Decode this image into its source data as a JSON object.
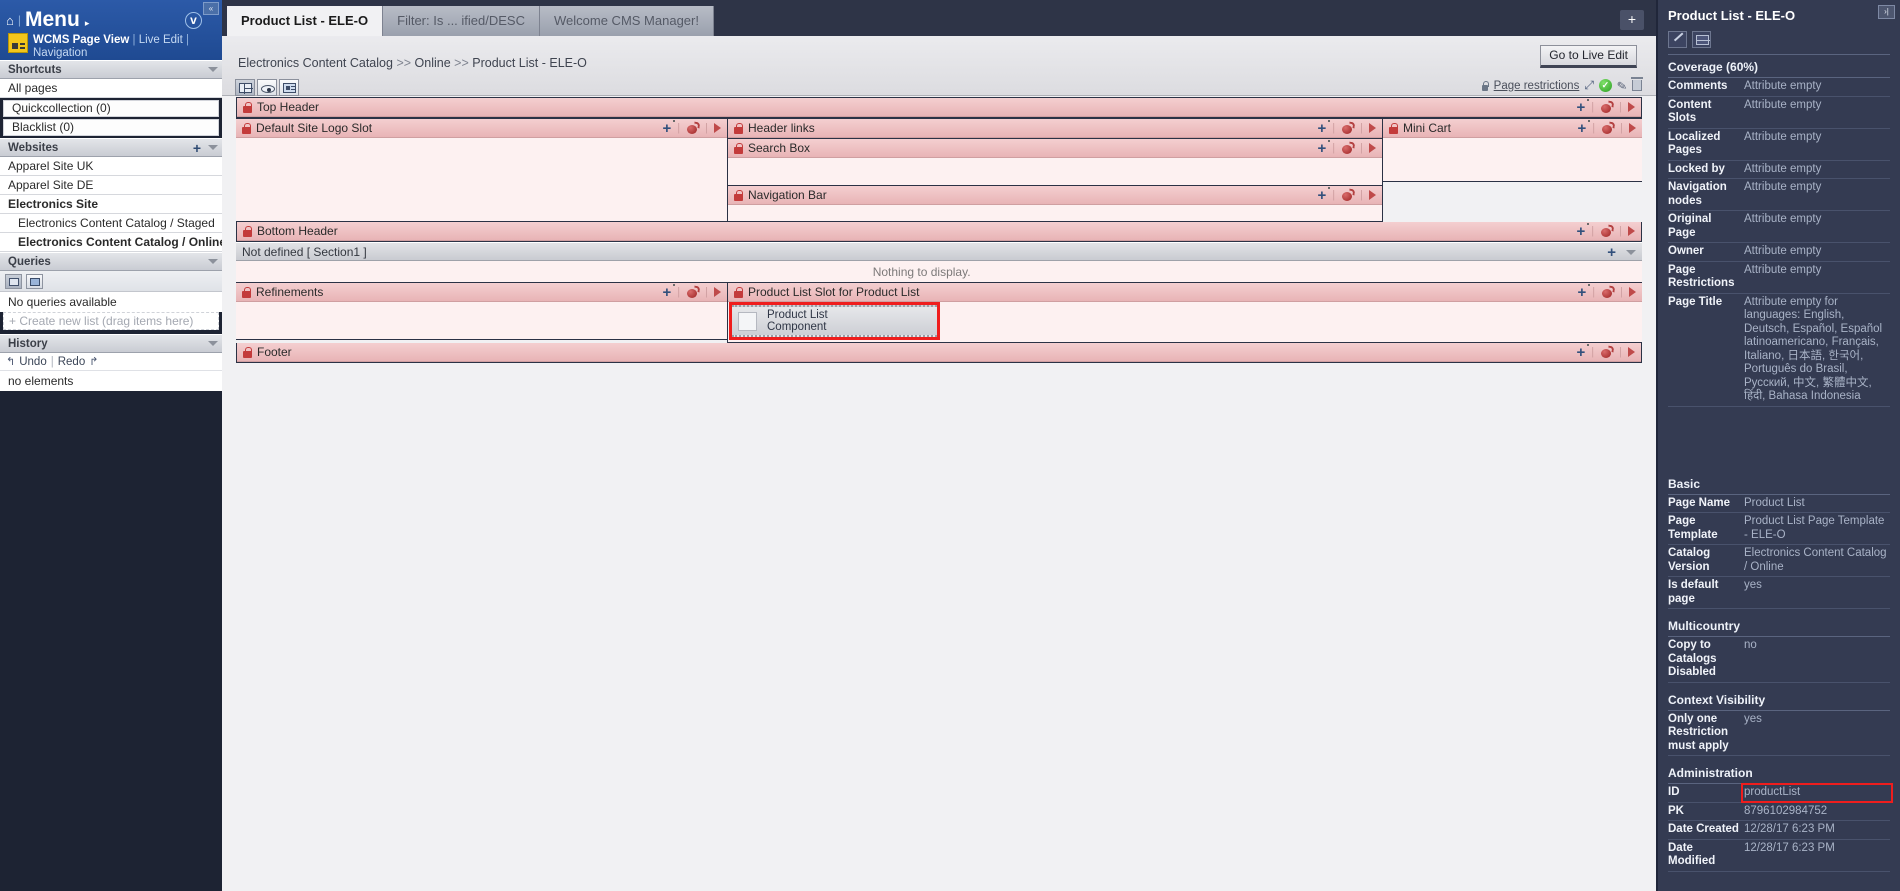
{
  "sidebar": {
    "collapse_icon": "«",
    "home_icon": "⌂",
    "menu_label": "Menu",
    "menu_caret": "▸",
    "version_badge": "v",
    "page_view_label": "WCMS Page View",
    "live_edit_label": "Live Edit",
    "navigation_label": "Navigation",
    "sections": {
      "shortcuts": {
        "title": "Shortcuts",
        "items": [
          {
            "label": "All pages",
            "style": "plain"
          },
          {
            "label": "Quickcollection (0)",
            "style": "boxed"
          },
          {
            "label": "Blacklist (0)",
            "style": "boxed"
          }
        ]
      },
      "websites": {
        "title": "Websites",
        "items": [
          {
            "label": "Apparel Site UK",
            "style": "plain"
          },
          {
            "label": "Apparel Site DE",
            "style": "plain"
          },
          {
            "label": "Electronics Site",
            "style": "bold"
          },
          {
            "label": "Electronics Content Catalog / Staged",
            "style": "indent-reg"
          },
          {
            "label": "Electronics Content Catalog / Online",
            "style": "indent"
          }
        ]
      },
      "queries": {
        "title": "Queries",
        "tool_icons": [
          "query-list-icon",
          "query-saved-icon"
        ],
        "empty_text": "No queries available",
        "create_text": "+ Create new list (drag items here)"
      },
      "history": {
        "title": "History",
        "undo_label": "Undo",
        "redo_label": "Redo",
        "empty_text": "no elements"
      }
    }
  },
  "tabs": [
    {
      "label": "Product List - ELE-O",
      "active": true
    },
    {
      "label": "Filter: Is ... ified/DESC",
      "active": false
    },
    {
      "label": "Welcome CMS Manager!",
      "active": false
    }
  ],
  "tab_add_label": "+",
  "breadcrumb": {
    "parts": [
      "Electronics Content Catalog",
      "Online",
      "Product List - ELE-O"
    ],
    "separator": ">>"
  },
  "live_edit_button": "Go to Live Edit",
  "view_tools": [
    "slot-grid-icon",
    "preview-eye-icon",
    "component-card-icon"
  ],
  "restrictions": {
    "lock_icon": "lock-icon",
    "label": "Page restrictions",
    "icons": [
      "move-icon",
      "approved-check-icon",
      "edit-pencil-icon",
      "delete-trash-icon"
    ]
  },
  "slots": {
    "top_header": "Top Header",
    "default_site_logo_slot": "Default Site Logo Slot",
    "header_links": "Header links",
    "search_box": "Search Box",
    "mini_cart": "Mini Cart",
    "navigation_bar": "Navigation Bar",
    "bottom_header": "Bottom Header",
    "not_defined": "Not defined [ Section1 ]",
    "nothing_to_display": "Nothing to display.",
    "refinements": "Refinements",
    "product_list_slot": "Product List Slot for Product List",
    "footer": "Footer",
    "component": {
      "line1": "Product List",
      "line2": "Component"
    },
    "action_icons": [
      "add-plus-icon",
      "bomb-icon",
      "play-icon"
    ]
  },
  "right_panel": {
    "title": "Product List - ELE-O",
    "expand_icon": "›|",
    "tools": [
      "edit-pencil-icon",
      "properties-table-icon"
    ],
    "groups": [
      {
        "title": "Coverage  (60%)",
        "rows": [
          {
            "key": "Comments",
            "value": "Attribute empty"
          },
          {
            "key": "Content Slots",
            "value": "Attribute empty"
          },
          {
            "key": "Localized Pages",
            "value": "Attribute empty"
          },
          {
            "key": "Locked by",
            "value": "Attribute empty"
          },
          {
            "key": "Navigation nodes",
            "value": "Attribute empty"
          },
          {
            "key": "Original Page",
            "value": "Attribute empty"
          },
          {
            "key": "Owner",
            "value": "Attribute empty"
          },
          {
            "key": "Page Restrictions",
            "value": "Attribute empty"
          },
          {
            "key": "Page Title",
            "value": "Attribute empty for languages: English, Deutsch, Español, Español latinoamericano, Français, Italiano, 日本語, 한국어, Português do Brasil, Русский, 中文, 繁體中文, हिंदी, Bahasa Indonesia"
          }
        ]
      },
      {
        "title": "Basic",
        "rows": [
          {
            "key": "Page Name",
            "value": "Product List"
          },
          {
            "key": "Page Template",
            "value": "Product List Page Template - ELE-O"
          },
          {
            "key": "Catalog Version",
            "value": "Electronics Content Catalog / Online"
          },
          {
            "key": "Is default page",
            "value": "yes"
          }
        ]
      },
      {
        "title": "Multicountry",
        "rows": [
          {
            "key": "Copy to Catalogs Disabled",
            "value": "no"
          }
        ]
      },
      {
        "title": "Context Visibility",
        "rows": [
          {
            "key": "Only one Restriction must apply",
            "value": "yes"
          }
        ]
      },
      {
        "title": "Administration",
        "rows": [
          {
            "key": "ID",
            "value": "productList",
            "highlight": true
          },
          {
            "key": "PK",
            "value": "8796102984752"
          },
          {
            "key": "Date Created",
            "value": "12/28/17 6:23 PM"
          },
          {
            "key": "Date Modified",
            "value": "12/28/17 6:23 PM"
          }
        ]
      }
    ]
  },
  "colors": {
    "sidebar_menu_blue": "#2c5aa8",
    "panel_navy": "#343b52",
    "slot_header_pink": "#e8b4b6",
    "slot_body_pink": "#fdf1f1",
    "highlight_red": "#ef1d1d",
    "approved_green": "#2da023"
  }
}
